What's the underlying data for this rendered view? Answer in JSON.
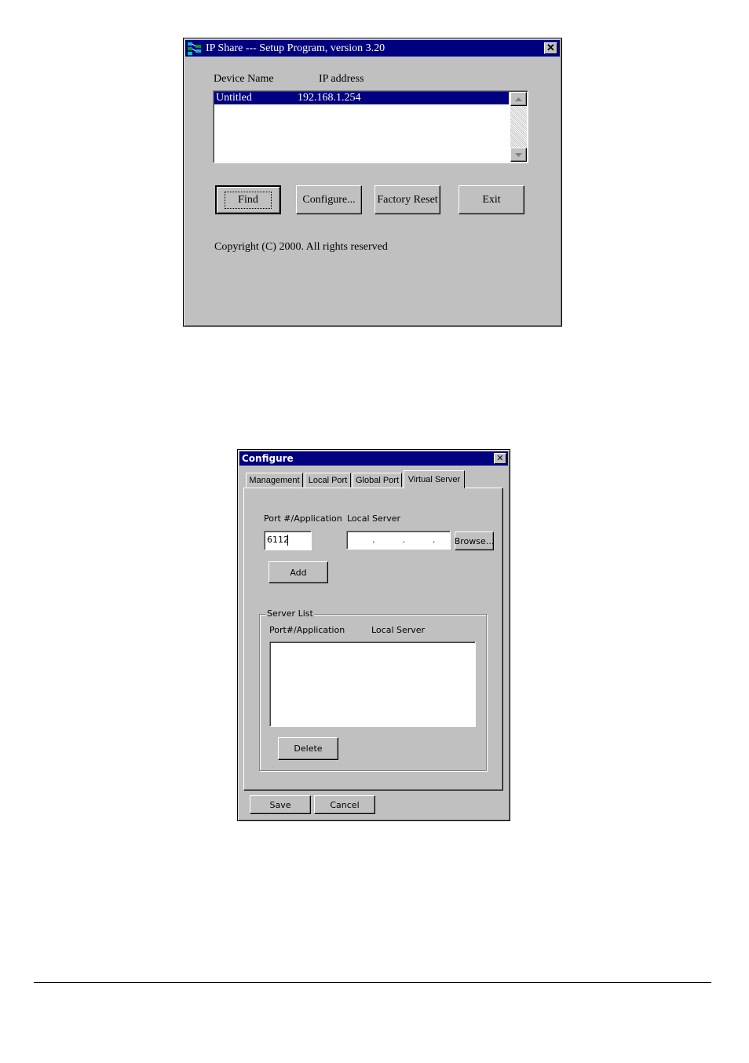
{
  "setup_window": {
    "title": "IP Share --- Setup Program, version 3.20",
    "close_glyph": "✕",
    "columns": {
      "device_name": "Device Name",
      "ip_address": "IP address"
    },
    "devices": [
      {
        "name": "Untitled",
        "ip": "192.168.1.254"
      }
    ],
    "buttons": {
      "find": "Find",
      "configure": "Configure...",
      "factory_reset": "Factory Reset",
      "exit": "Exit"
    },
    "copyright": "Copyright (C) 2000.  All rights reserved",
    "icon": "network-app-icon"
  },
  "configure_window": {
    "title": "Configure",
    "close_glyph": "✕",
    "tabs": [
      "Management",
      "Local Port",
      "Global Port",
      "Virtual Server"
    ],
    "active_tab": "Virtual Server",
    "port_label": "Port #/Application",
    "local_server_label": "Local Server",
    "port_value": "6112",
    "ip_dots": ".          .          .",
    "browse": "Browse...",
    "add": "Add",
    "server_list": {
      "legend": "Server List",
      "col_port": "Port#/Application",
      "col_server": "Local Server"
    },
    "delete": "Delete",
    "save": "Save",
    "cancel": "Cancel"
  },
  "colors": {
    "titlebar": "#000080",
    "face": "#c0c0c0",
    "selection": "#000080"
  }
}
